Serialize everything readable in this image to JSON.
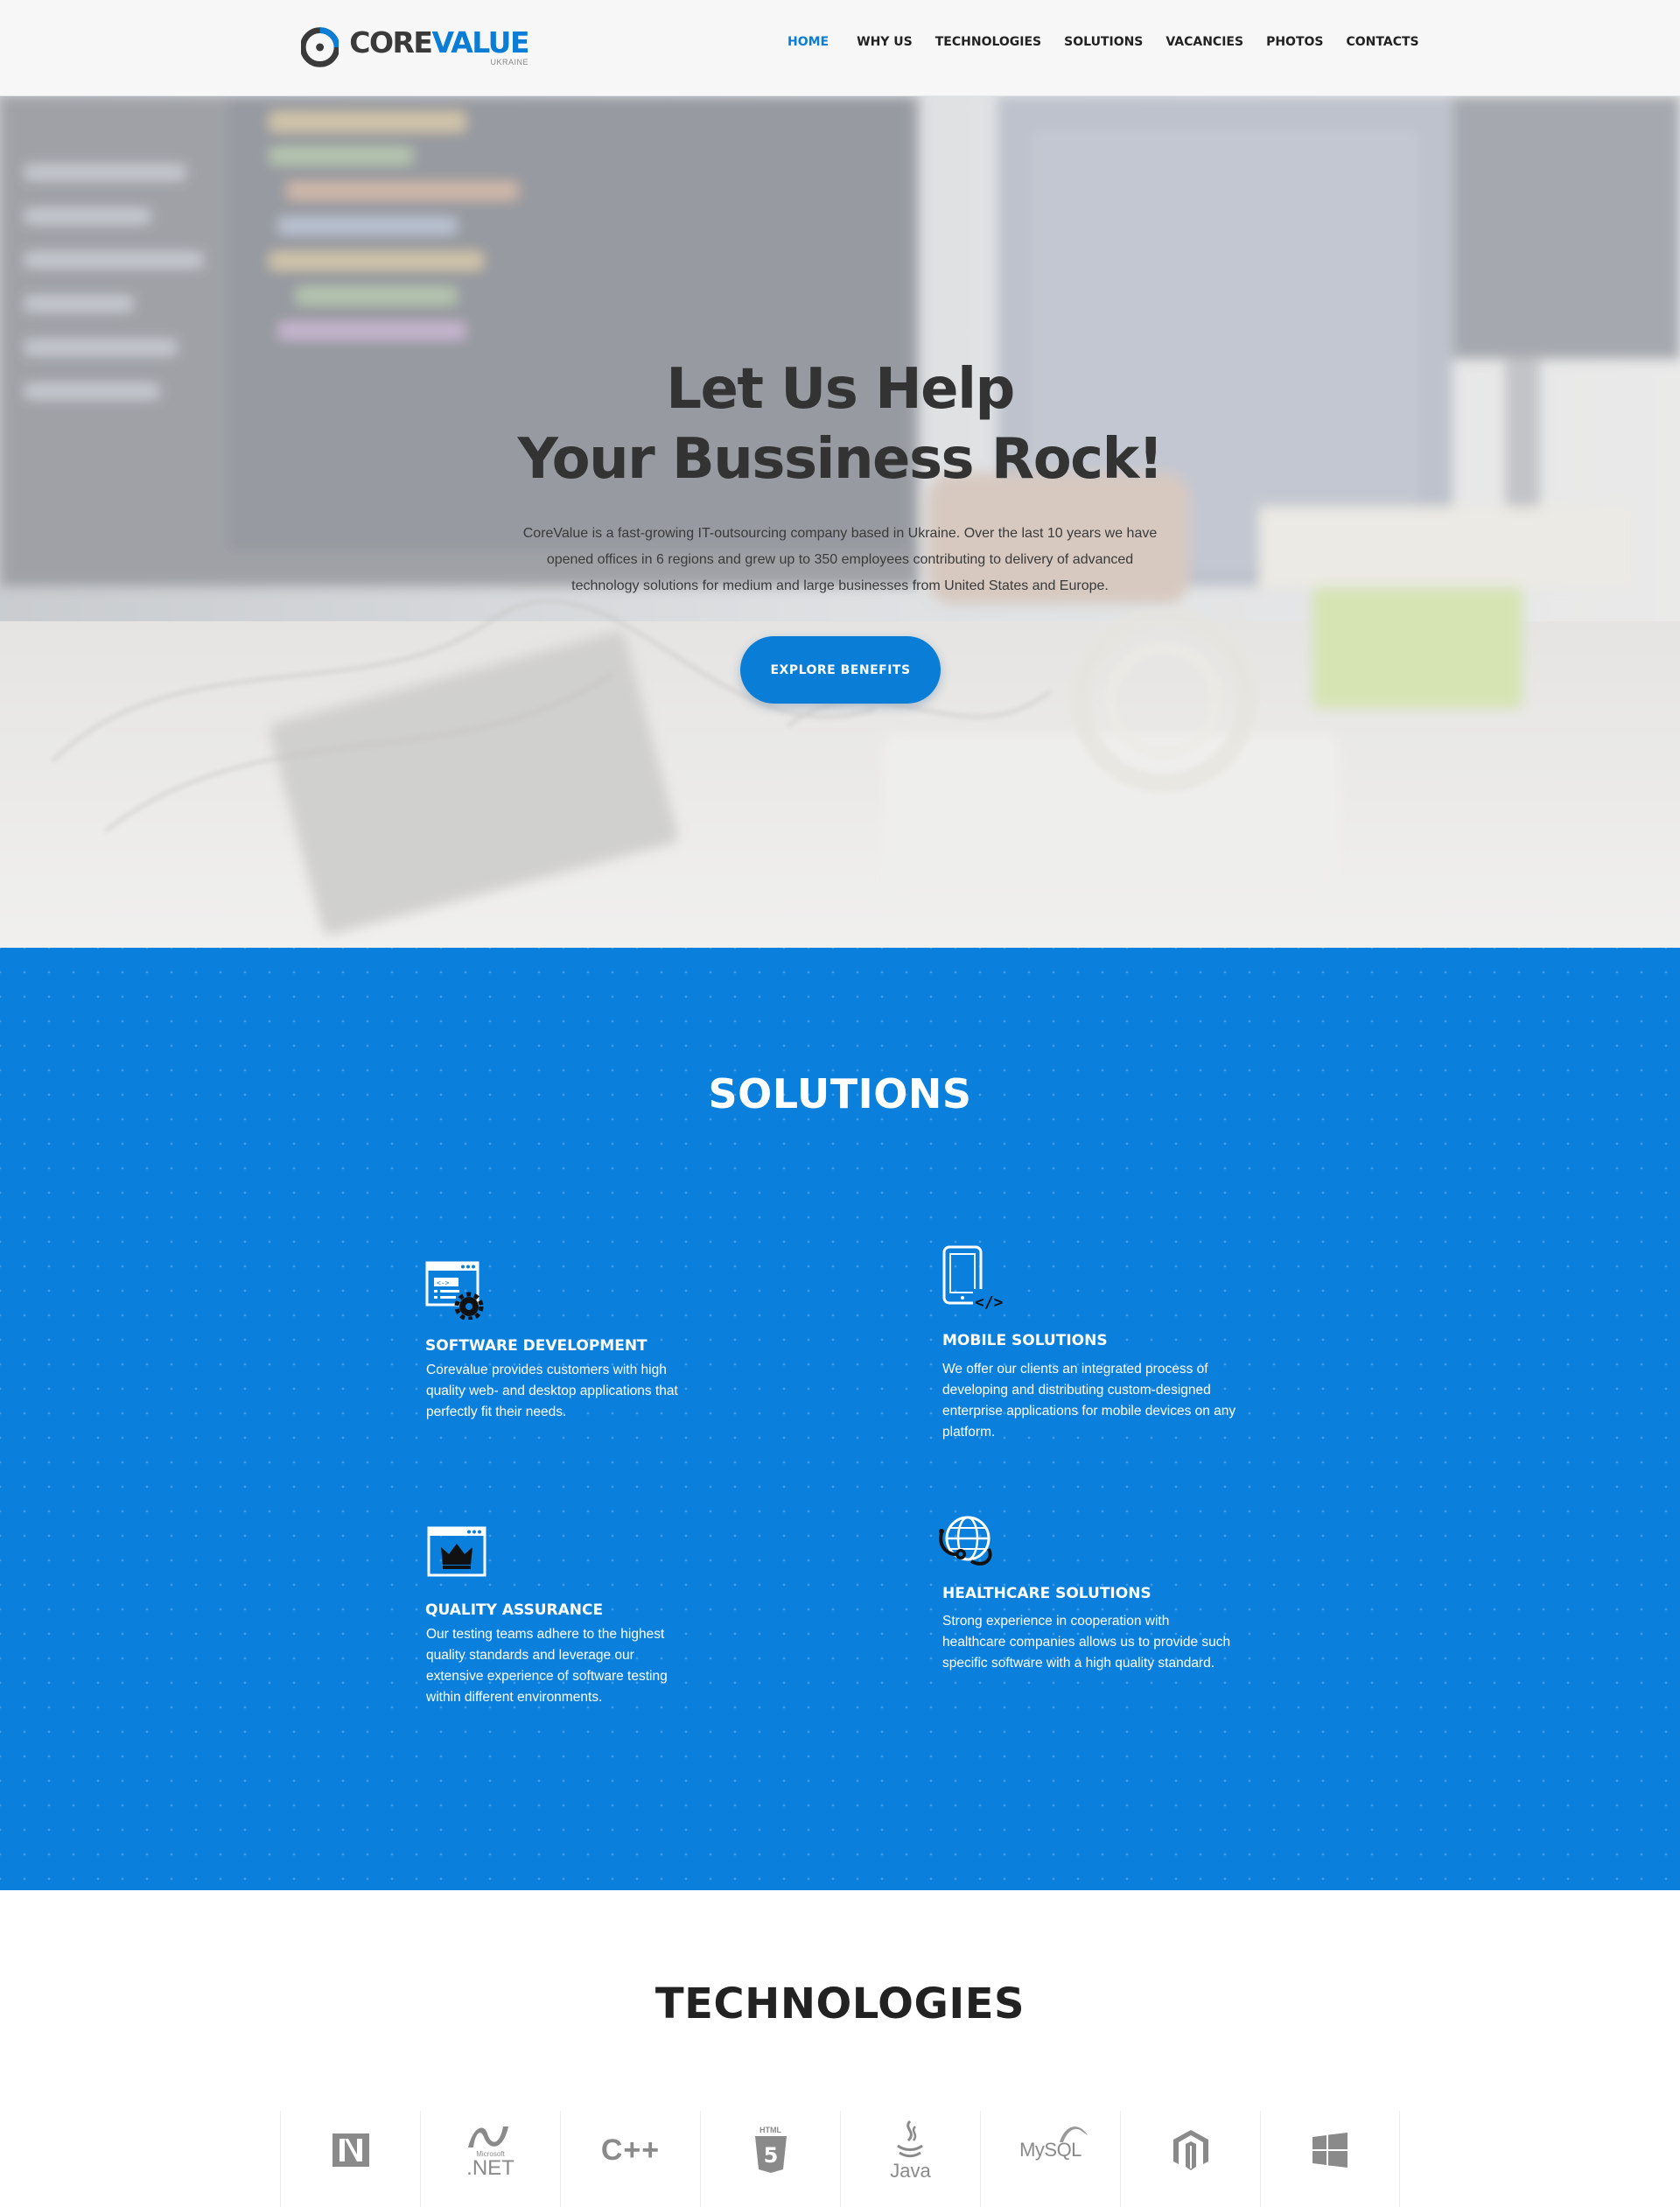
{
  "header": {
    "logo_word_a": "CORE",
    "logo_word_b": "VALUE",
    "logo_sub": "UKRAINE",
    "nav": [
      "HOME",
      "WHY US",
      "TECHNOLOGIES",
      "SOLUTIONS",
      "VACANCIES",
      "PHOTOS",
      "CONTACTS"
    ],
    "active_nav": "HOME"
  },
  "hero": {
    "title_line1": "Let Us Help",
    "title_line2": "Your Bussiness Rock!",
    "description_line1": "CoreValue is a fast-growing IT-outsourcing company based in Ukraine. Over the last 10 years we have",
    "description_line2": "opened offices in 6 regions and grew up to 350 employees contributing to delivery of advanced",
    "description_line3": "technology solutions for medium and large businesses from United States and Europe.",
    "button_label": "EXPLORE  BENEFITS"
  },
  "solutions": {
    "title": "SOLUTIONS",
    "items": [
      {
        "icon": "software-development-icon",
        "name": "SOFTWARE DEVELOPMENT",
        "line1": "Corevalue  provides  customers  with  high",
        "line2": "quality web- and desktop applications that",
        "line3": "perfectly fit their needs.",
        "line4": ""
      },
      {
        "icon": "mobile-solutions-icon",
        "name": "MOBILE SOLUTIONS",
        "line1": "We offer our clients an integrated process of",
        "line2": "developing and distributing custom-designed",
        "line3": "enterprise applications for mobile devices on any",
        "line4": "platform."
      },
      {
        "icon": "quality-assurance-icon",
        "name": "QUALITY ASSURANCE",
        "line1": "Our testing teams adhere to the highest",
        "line2": "quality standards and leverage our",
        "line3": "extensive experience of software testing",
        "line4": "within different environments."
      },
      {
        "icon": "healthcare-solutions-icon",
        "name": "HEALTHCARE SOLUTIONS",
        "line1": "Strong experience in cooperation with",
        "line2": "healthcare companies allows us to provide such",
        "line3": "specific software with a high quality standard.",
        "line4": ""
      }
    ]
  },
  "technologies": {
    "title": "TECHNOLOGIES",
    "logos": [
      {
        "icon": "netsuite-logo-icon",
        "label": ""
      },
      {
        "icon": "dotnet-logo-icon",
        "label": ".NET",
        "sub": "Microsoft"
      },
      {
        "icon": "cpp-logo-icon",
        "label": "C++"
      },
      {
        "icon": "html5-logo-icon",
        "label": "5",
        "sub": "HTML"
      },
      {
        "icon": "java-logo-icon",
        "label": "Java"
      },
      {
        "icon": "mysql-logo-icon",
        "label": "MySQL"
      },
      {
        "icon": "magento-logo-icon",
        "label": ""
      },
      {
        "icon": "windows-logo-icon",
        "label": ""
      }
    ]
  },
  "colors": {
    "brand_blue": "#0a7dd6",
    "solutions_bg": "#0a7fdc",
    "dark_text": "#333333"
  }
}
